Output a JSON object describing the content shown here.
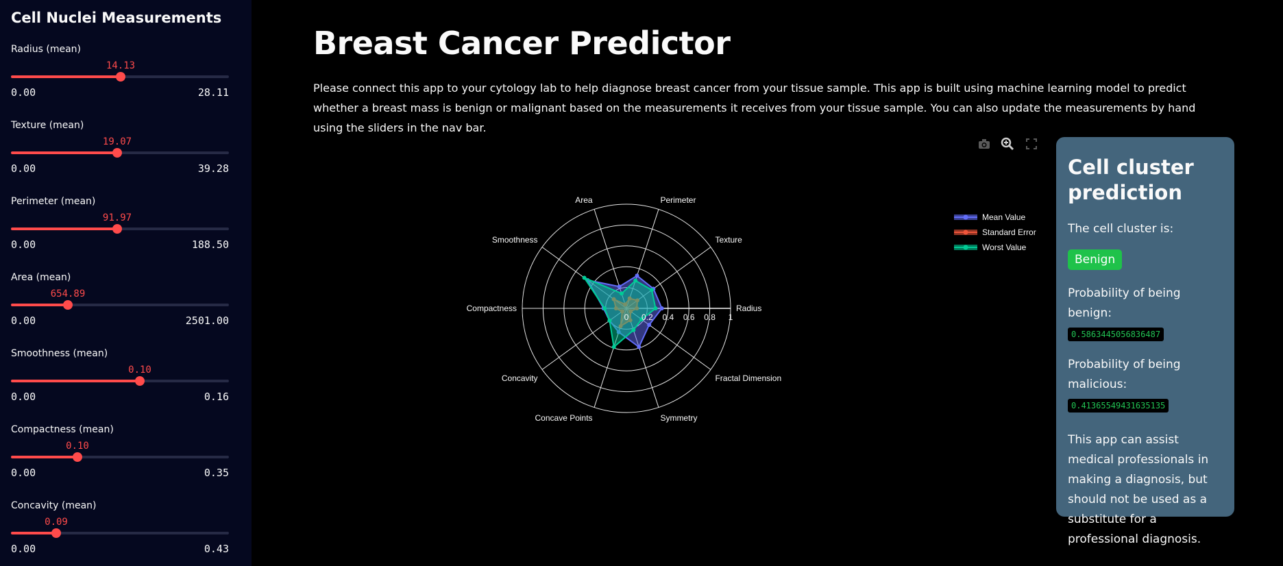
{
  "sidebar": {
    "title": "Cell Nuclei Measurements",
    "sliders": [
      {
        "label": "Radius (mean)",
        "value": "14.13",
        "min": "0.00",
        "max": "28.11",
        "fraction": 0.503
      },
      {
        "label": "Texture (mean)",
        "value": "19.07",
        "min": "0.00",
        "max": "39.28",
        "fraction": 0.486
      },
      {
        "label": "Perimeter (mean)",
        "value": "91.97",
        "min": "0.00",
        "max": "188.50",
        "fraction": 0.488
      },
      {
        "label": "Area (mean)",
        "value": "654.89",
        "min": "0.00",
        "max": "2501.00",
        "fraction": 0.262
      },
      {
        "label": "Smoothness (mean)",
        "value": "0.10",
        "min": "0.00",
        "max": "0.16",
        "fraction": 0.592
      },
      {
        "label": "Compactness (mean)",
        "value": "0.10",
        "min": "0.00",
        "max": "0.35",
        "fraction": 0.305
      },
      {
        "label": "Concavity (mean)",
        "value": "0.09",
        "min": "0.00",
        "max": "0.43",
        "fraction": 0.208
      }
    ]
  },
  "main": {
    "title": "Breast Cancer Predictor",
    "intro": "Please connect this app to your cytology lab to help diagnose breast cancer from your tissue sample. This app is built using machine learning model to predict whether a breast mass is benign or malignant based on the measurements it receives from your tissue sample. You can also update the measurements by hand using the sliders in the nav bar."
  },
  "toolbar": {
    "icons": [
      "camera-icon",
      "zoom-icon",
      "fullscreen-icon"
    ]
  },
  "chart_data": {
    "type": "radar",
    "categories": [
      "Radius",
      "Texture",
      "Perimeter",
      "Area",
      "Smoothness",
      "Compactness",
      "Concavity",
      "Concave Points",
      "Symmetry",
      "Fractal Dimension"
    ],
    "radial_ticks": [
      "0",
      "0.2",
      "0.4",
      "0.6",
      "0.8",
      "1"
    ],
    "radial_range": [
      0,
      1
    ],
    "series": [
      {
        "name": "Mean Value",
        "color": "#636efa",
        "values": [
          0.34,
          0.32,
          0.33,
          0.22,
          0.46,
          0.22,
          0.2,
          0.24,
          0.39,
          0.27
        ]
      },
      {
        "name": "Standard Error",
        "color": "#ef553b",
        "values": [
          0.1,
          0.13,
          0.1,
          0.04,
          0.15,
          0.1,
          0.05,
          0.18,
          0.12,
          0.05
        ]
      },
      {
        "name": "Worst Value",
        "color": "#00cc96",
        "values": [
          0.28,
          0.3,
          0.28,
          0.15,
          0.5,
          0.21,
          0.2,
          0.39,
          0.22,
          0.18
        ]
      }
    ],
    "legend_placement": "top-right"
  },
  "panel": {
    "title": "Cell cluster prediction",
    "cluster_label": "The cell cluster is:",
    "cluster_result": "Benign",
    "benign_label": "Probability of being benign:",
    "benign_value": "0.5863445056836487",
    "malicious_label": "Probability of being malicious:",
    "malicious_value": "0.41365549431635135",
    "disclaimer": "This app can assist medical professionals in making a diagnosis, but should not be used as a substitute for a professional diagnosis.",
    "colors": {
      "panel_bg": "#44657c",
      "badge_bg": "#1fc24a"
    }
  }
}
